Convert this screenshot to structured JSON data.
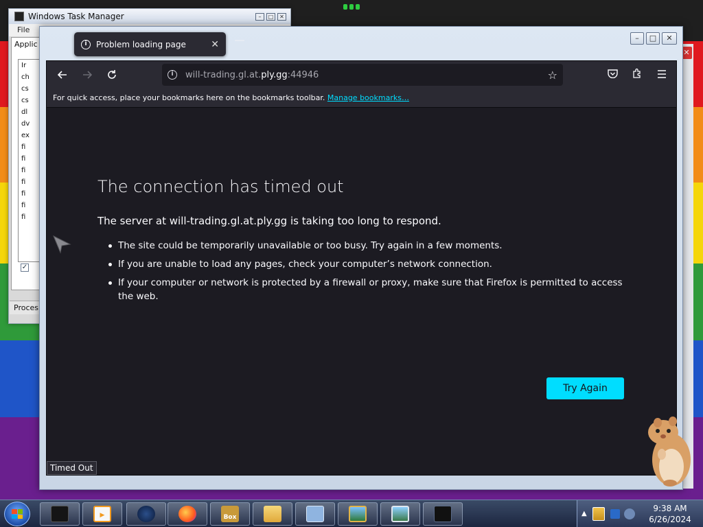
{
  "task_manager": {
    "title": "Windows Task Manager",
    "menu_file": "File",
    "tab_label": "Applic",
    "list_header": "Ir",
    "list_rows": [
      "ch",
      "cs",
      "cs",
      "dl",
      "dv",
      "ex",
      "fi",
      "fi",
      "fi",
      "fi",
      "fi",
      "fi",
      "fi"
    ],
    "status_text": "Proces"
  },
  "firefox": {
    "tab_title": "Problem loading page",
    "url_prefix": "will-trading.gl.at.",
    "url_domain": "ply.gg",
    "url_port": ":44946",
    "bookmarks_text": "For quick access, place your bookmarks here on the bookmarks toolbar.",
    "bookmarks_link": "Manage bookmarks…",
    "error_title": "The connection has timed out",
    "error_subtitle": "The server at will-trading.gl.at.ply.gg is taking too long to respond.",
    "error_items": [
      "The site could be temporarily unavailable or too busy. Try again in a few moments.",
      "If you are unable to load any pages, check your computer’s network connection.",
      "If your computer or network is protected by a firewall or proxy, make sure that Firefox is permitted to access the web."
    ],
    "try_again_label": "Try Again",
    "status_label": "Timed Out",
    "accent_color": "#00ddff",
    "bg_color": "#1c1b22"
  },
  "taskbar": {
    "pinned_icons": [
      "terminal-app-icon",
      "media-player-icon",
      "globe-browser-icon",
      "firefox-icon",
      "box-app-icon",
      "folder-icon",
      "network-computer-icon",
      "image-viewer-icon",
      "picture-icon",
      "terminal-window-icon"
    ],
    "box_label": "Box",
    "clock_time": "9:38 AM",
    "clock_date": "6/26/2024"
  },
  "sliver_close": "✕"
}
